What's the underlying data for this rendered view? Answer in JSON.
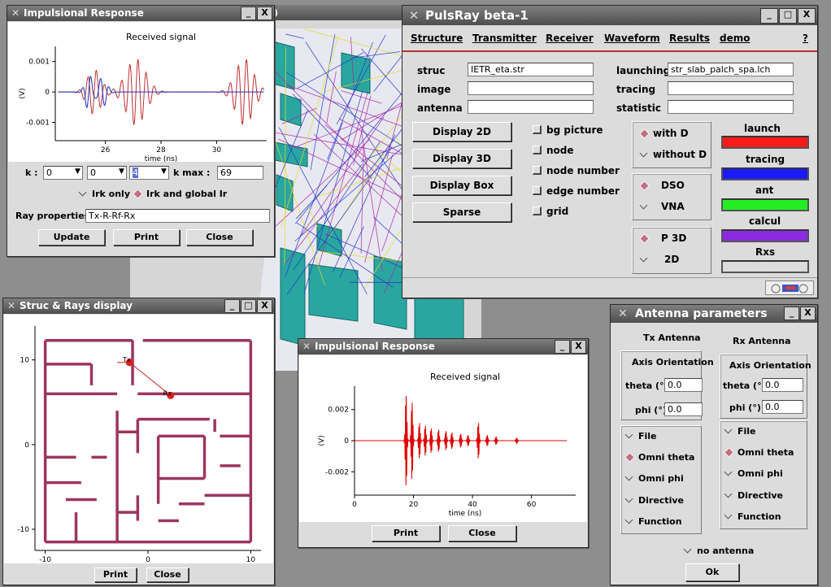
{
  "colors": {
    "tracing_red": "#e52020",
    "ray_blue": "#2020d0",
    "signal_red": "#e00000",
    "wall": "#9c3560",
    "launch": "#ff1a1a",
    "tracing": "#1a1aff",
    "ant": "#22ee22",
    "calcul": "#8a2be2",
    "floor": "#2aa6a0"
  },
  "icons": {
    "title": "x-icon",
    "minimize": "minimize-icon",
    "maximize": "maximize-icon",
    "close": "close-icon",
    "logo": "pulsray-logo-icon"
  },
  "bg_title_partial": ")",
  "ir1": {
    "title": "Impulsional Response",
    "minimize": "_",
    "close": "X",
    "chart_title": "Received signal",
    "xlabel": "time (ns)",
    "ylabel": "(V)",
    "xticks": [
      "26",
      "28",
      "30"
    ],
    "yticks": [
      "0.001",
      "0",
      "-0.001"
    ],
    "k_label": "k :",
    "k1": "0",
    "k2": "0",
    "k3": "4",
    "kmax_label": "k max :",
    "kmax": "69",
    "irk_only": "Irk only",
    "irk_global": "Irk and global Ir",
    "ray_prop_label": "Ray properties",
    "ray_prop_value": "Tx-R-Rf-Rx",
    "update": "Update",
    "print": "Print",
    "close_btn": "Close"
  },
  "chart_data": [
    {
      "type": "line",
      "title": "Received signal",
      "xlabel": "time (ns)",
      "ylabel": "(V)",
      "xlim": [
        24.2,
        31.8
      ],
      "ylim": [
        -0.0016,
        0.0015
      ],
      "series": [
        {
          "color": "#c03030"
        },
        {
          "color": "#2030c0"
        }
      ]
    },
    {
      "type": "line",
      "title": "Received signal",
      "xlabel": "time (ns)",
      "ylabel": "(V)",
      "xlim": [
        0,
        75
      ],
      "ylim": [
        -0.0035,
        0.0035
      ],
      "series": [
        {
          "color": "#e00000"
        }
      ]
    },
    {
      "type": "scatter",
      "xlim": [
        -11,
        11
      ],
      "ylim": [
        -12.5,
        14
      ],
      "points": [
        {
          "label": "Tx",
          "x": -1.8,
          "y": 9.7
        },
        {
          "label": "Rx",
          "x": 2.2,
          "y": 5.8
        }
      ]
    }
  ],
  "ir2": {
    "title": "Impulsional Response",
    "minimize": "_",
    "close": "X",
    "chart_title": "Received signal",
    "xlabel": "time (ns)",
    "ylabel": "(V)",
    "xticks": [
      "0",
      "20",
      "40",
      "60"
    ],
    "yticks": [
      "0.002",
      "0",
      "-0.002"
    ],
    "print": "Print",
    "close_btn": "Close"
  },
  "struc": {
    "title": "Struc & Rays display",
    "minimize": "_",
    "maximize": "□",
    "close": "X",
    "xticks": [
      "-10",
      "0",
      "10"
    ],
    "yticks": [
      "10",
      "0",
      "-10"
    ],
    "tx": "Tx",
    "rx": "Rx",
    "print": "Print",
    "close_btn": "Close"
  },
  "pulsray": {
    "title": "PulsRay beta-1",
    "minimize": "_",
    "maximize": "□",
    "close": "X",
    "menu": [
      "Structure",
      "Transmitter",
      "Receiver",
      "Waveform",
      "Results",
      "demo",
      "?"
    ],
    "struc_label": "struc",
    "struc_value": "IETR_eta.str",
    "image_label": "image",
    "image_value": "",
    "antenna_label": "antenna",
    "antenna_value": "",
    "launching_label": "launching",
    "launching_value": "str_slab_palch_spa.lch",
    "tracing_label": "tracing",
    "tracing_value": "",
    "statistic_label": "statistic",
    "statistic_value": "",
    "buttons": [
      "Display 2D",
      "Display 3D",
      "Display Box",
      "Sparse"
    ],
    "checks": [
      "bg picture",
      "node",
      "node number",
      "edge number",
      "grid"
    ],
    "with_d": "with D",
    "without_d": "without D",
    "dso": "DSO",
    "vna": "VNA",
    "p3d": "P 3D",
    "d2": "2D",
    "status": [
      "launch",
      "tracing",
      "ant",
      "calcul",
      "Rxs"
    ]
  },
  "antenna": {
    "title": "Antenna parameters",
    "minimize": "_",
    "close": "X",
    "tx": "Tx Antenna",
    "rx": "Rx Antenna",
    "axis": "Axis Orientation",
    "theta": "theta (°)",
    "phi": "phi (°)",
    "tx_theta": "0.0",
    "tx_phi": "0.0",
    "rx_theta": "0.0",
    "rx_phi": "0.0",
    "options": [
      "File",
      "Omni theta",
      "Omni phi",
      "Directive",
      "Function"
    ],
    "no_antenna": "no antenna",
    "ok": "Ok"
  }
}
